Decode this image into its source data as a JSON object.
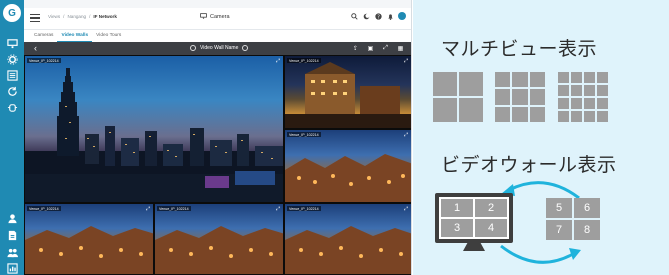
{
  "sidebar": {
    "logo": "G",
    "top_icons": [
      "monitor-icon",
      "gear-icon",
      "list-icon",
      "refresh-icon",
      "bug-icon"
    ],
    "bottom_icons": [
      "user-icon",
      "document-icon",
      "users-icon",
      "report-icon"
    ]
  },
  "header": {
    "breadcrumb": [
      "Views",
      "Nangang",
      "IF Network"
    ],
    "title": "Camera",
    "icons": [
      "search-icon",
      "moon-icon",
      "help-icon",
      "bell-icon",
      "avatar"
    ]
  },
  "tabs": [
    {
      "label": "Cameras",
      "active": false
    },
    {
      "label": "Video Walls",
      "active": true
    },
    {
      "label": "Video Tours",
      "active": false
    }
  ],
  "wall": {
    "back": "‹",
    "name": "Video Wall Name",
    "tools": [
      "upload-icon",
      "camera-icon",
      "fullscreen-icon",
      "grid-icon"
    ],
    "tiles": [
      {
        "label": "Venue_IP_102214"
      },
      {
        "label": "Venue_IP_102214"
      },
      {
        "label": "Venue_IP_102214"
      },
      {
        "label": "Venue_IP_102214"
      },
      {
        "label": "Venue_IP_102214"
      },
      {
        "label": "Venue_IP_102214"
      }
    ]
  },
  "illustration": {
    "multiview_title": "マルチビュー表示",
    "videowall_title": "ビデオウォール表示",
    "monitor_cells": [
      "1",
      "2",
      "3",
      "4"
    ],
    "mini_cells": [
      "5",
      "6",
      "7",
      "8"
    ],
    "accent": "#1fb3dc"
  }
}
